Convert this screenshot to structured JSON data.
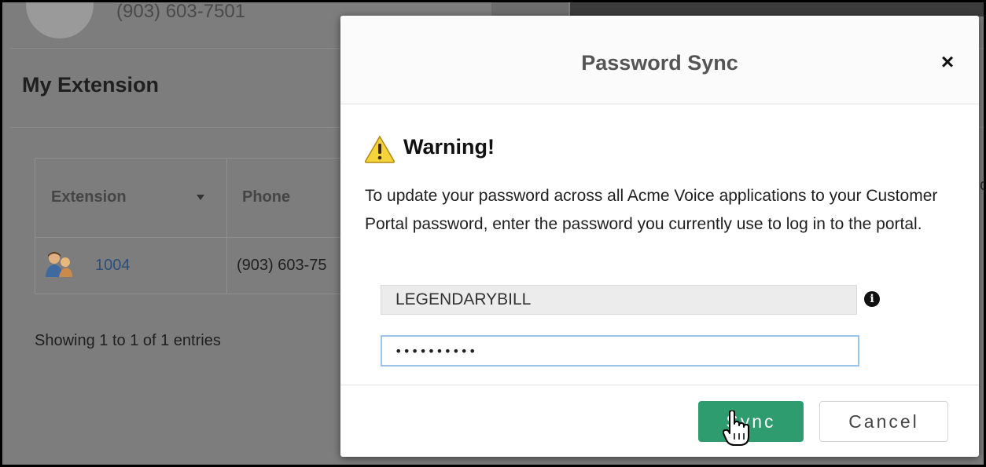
{
  "background": {
    "profile_phone": "(903) 603-7501",
    "card_title": "My Extension",
    "table": {
      "headers": [
        "Extension",
        "Phone"
      ],
      "rows": [
        {
          "extension": "1004",
          "phone": "(903) 603-75"
        }
      ]
    },
    "entries_info": "Showing 1 to 1 of 1 entries",
    "edge_char": "c"
  },
  "modal": {
    "title": "Password Sync",
    "close": "×",
    "warning_title": "Warning!",
    "warning_text": "To update your password across all Acme Voice applications to your Customer Portal password, enter the password you currently use to log in to the portal.",
    "username_value": "LEGENDARYBILL",
    "password_value": "••••••••••",
    "sync_label": "Sync",
    "cancel_label": "Cancel"
  },
  "colors": {
    "overlay": "#7d7d7d",
    "sync_button": "#2e9c6f",
    "focus_border": "#9cc4e8"
  },
  "icons": [
    "user-icon",
    "warning-icon",
    "info-icon",
    "close-icon",
    "sort-caret-icon",
    "hand-cursor-icon"
  ]
}
